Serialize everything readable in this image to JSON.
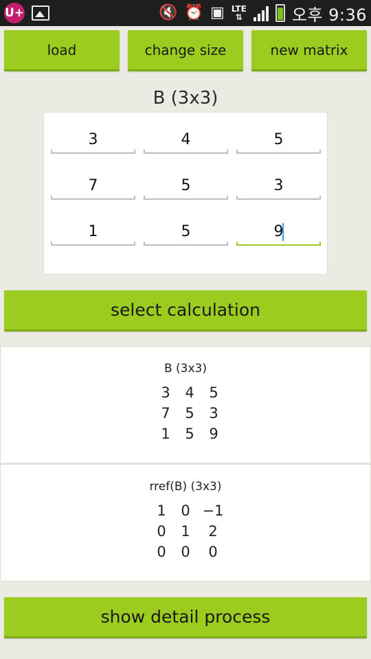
{
  "status_bar": {
    "carrier_icon": "uplus-icon",
    "carrier_label": "U+",
    "time": "오후 9:36",
    "carrier_text": "LTE"
  },
  "toolbar": {
    "load_label": "load",
    "change_size_label": "change size",
    "new_matrix_label": "new matrix"
  },
  "editor": {
    "title": "B (3x3)",
    "cells": [
      [
        "3",
        "4",
        "5"
      ],
      [
        "7",
        "5",
        "3"
      ],
      [
        "1",
        "5",
        "9"
      ]
    ]
  },
  "select_calculation_label": "select calculation",
  "results": [
    {
      "title": "B (3x3)",
      "rows": [
        [
          "3",
          "4",
          "5"
        ],
        [
          "7",
          "5",
          "3"
        ],
        [
          "1",
          "5",
          "9"
        ]
      ]
    },
    {
      "title": "rref(B) (3x3)",
      "rows": [
        [
          "1",
          "0",
          "−1"
        ],
        [
          "0",
          "1",
          "2"
        ],
        [
          "0",
          "0",
          "0"
        ]
      ]
    }
  ],
  "show_detail_label": "show detail process",
  "colors": {
    "accent": "#9bcc1f",
    "background": "#ebebe3",
    "status_bar": "#1e1e1e"
  }
}
